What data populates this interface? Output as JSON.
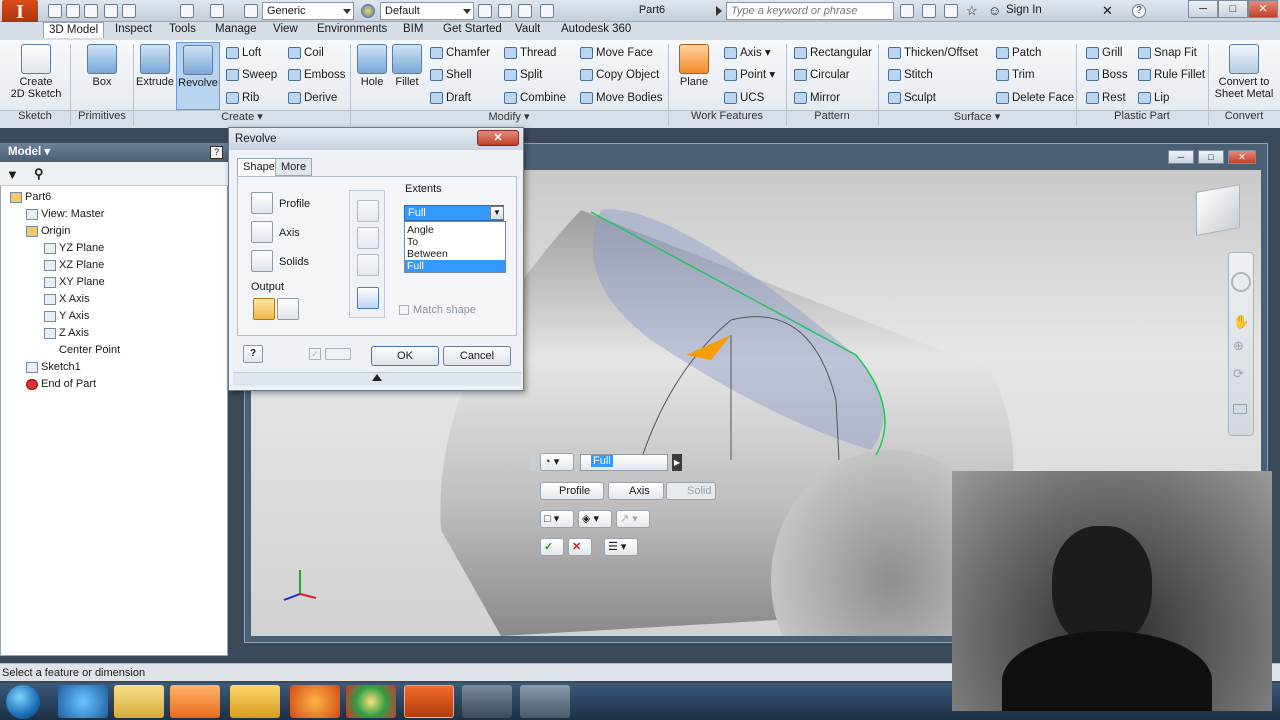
{
  "titlebar": {
    "app_letter": "I",
    "material": "Generic",
    "appearance": "Default",
    "document": "Part6",
    "search_placeholder": "Type a keyword or phrase",
    "sign_in": "Sign In"
  },
  "menu": [
    "3D Model",
    "Inspect",
    "Tools",
    "Manage",
    "View",
    "Environments",
    "BIM",
    "Get Started",
    "Vault",
    "Autodesk 360"
  ],
  "ribbon": {
    "sketch": {
      "create_2d_sketch": "Create\n2D Sketch",
      "label": "Sketch"
    },
    "primitives": {
      "box": "Box",
      "label": "Primitives"
    },
    "create": {
      "extrude": "Extrude",
      "revolve": "Revolve",
      "loft": "Loft",
      "sweep": "Sweep",
      "rib": "Rib",
      "coil": "Coil",
      "emboss": "Emboss",
      "derive": "Derive",
      "label": "Create ▾"
    },
    "modify": {
      "hole": "Hole",
      "fillet": "Fillet",
      "chamfer": "Chamfer",
      "shell": "Shell",
      "draft": "Draft",
      "thread": "Thread",
      "split": "Split",
      "combine": "Combine",
      "move_face": "Move Face",
      "copy_object": "Copy Object",
      "move_bodies": "Move Bodies",
      "label": "Modify ▾"
    },
    "work_features": {
      "plane": "Plane",
      "axis": "Axis ▾",
      "point": "Point ▾",
      "ucs": "UCS",
      "label": "Work Features"
    },
    "pattern": {
      "rectangular": "Rectangular",
      "circular": "Circular",
      "mirror": "Mirror",
      "label": "Pattern"
    },
    "surface": {
      "thicken": "Thicken/Offset",
      "stitch": "Stitch",
      "sculpt": "Sculpt",
      "patch": "Patch",
      "trim": "Trim",
      "delete_face": "Delete Face",
      "label": "Surface ▾"
    },
    "plastic_part": {
      "grill": "Grill",
      "boss": "Boss",
      "rest": "Rest",
      "snap_fit": "Snap Fit",
      "rule_fillet": "Rule Fillet",
      "lip": "Lip",
      "label": "Plastic Part"
    },
    "convert": {
      "sheet_metal": "Convert to\nSheet Metal",
      "label": "Convert"
    }
  },
  "model_browser": {
    "header": "Model ▾",
    "tree": [
      "Part6",
      "View: Master",
      "Origin",
      "YZ Plane",
      "XZ Plane",
      "XY Plane",
      "X Axis",
      "Y Axis",
      "Z Axis",
      "Center Point",
      "Sketch1",
      "End of Part"
    ]
  },
  "dialog": {
    "title": "Revolve",
    "tabs": [
      "Shape",
      "More"
    ],
    "profile": "Profile",
    "axis": "Axis",
    "solids": "Solids",
    "output": "Output",
    "extents": "Extents",
    "extents_value": "Full",
    "extents_options": [
      "Angle",
      "To",
      "Between",
      "Full"
    ],
    "match_shape": "Match shape",
    "ok": "OK",
    "cancel": "Cancel"
  },
  "minitoolbar": {
    "value": "Full",
    "profile": "Profile",
    "axis": "Axis",
    "solid": "Solid"
  },
  "status": "Select a feature or dimension"
}
